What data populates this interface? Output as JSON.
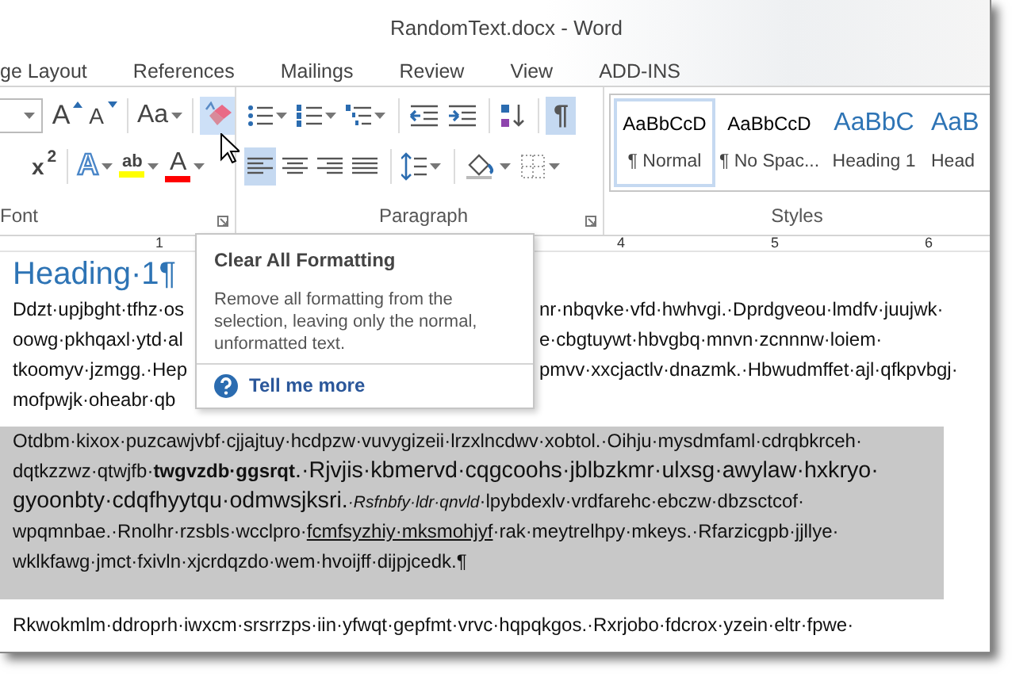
{
  "window": {
    "title": "RandomText.docx - Word"
  },
  "tabs": [
    {
      "label": "ge Layout"
    },
    {
      "label": "References"
    },
    {
      "label": "Mailings"
    },
    {
      "label": "Review"
    },
    {
      "label": "View"
    },
    {
      "label": "ADD-INS"
    }
  ],
  "font_group": {
    "label": "Font",
    "row1": [
      {
        "kind": "size_box"
      },
      {
        "kind": "grow",
        "glyph": "A"
      },
      {
        "kind": "shrink",
        "glyph": "A"
      },
      {
        "kind": "case",
        "glyph": "Aa"
      },
      {
        "kind": "clear",
        "hover": true
      }
    ],
    "row2": [
      {
        "kind": "superscript",
        "glyph": "x$^{2}$"
      },
      {
        "kind": "effects",
        "glyph": "A"
      },
      {
        "kind": "highlight",
        "glyph": "ab",
        "color": "#ffff00"
      },
      {
        "kind": "font_color",
        "glyph": "A",
        "color": "#ff0000"
      }
    ]
  },
  "paragraph_group": {
    "label": "Paragraph",
    "row1": [
      {
        "kind": "bullets"
      },
      {
        "kind": "numbering"
      },
      {
        "kind": "multilevel"
      },
      {
        "kind": "outdent"
      },
      {
        "kind": "indent"
      },
      {
        "kind": "sort"
      },
      {
        "kind": "pilcrow",
        "glyph": "¶",
        "selected": true
      }
    ],
    "row2": [
      {
        "kind": "align_left",
        "selected": true
      },
      {
        "kind": "align_center",
        "selected": false
      },
      {
        "kind": "align_right",
        "selected": false
      },
      {
        "kind": "justify",
        "selected": false
      },
      {
        "kind": "line_spacing"
      },
      {
        "kind": "shading"
      },
      {
        "kind": "borders"
      }
    ]
  },
  "styles_group": {
    "label": "Styles",
    "styles": [
      {
        "sample": "AaBbCcD",
        "name": "¶ Normal",
        "kind": "body",
        "selected": true
      },
      {
        "sample": "AaBbCcD",
        "name": "¶ No Spac...",
        "kind": "body",
        "selected": false
      },
      {
        "sample": "AaBbC",
        "name": "Heading 1",
        "kind": "heading",
        "selected": false
      },
      {
        "sample": "AaB",
        "name": "Head",
        "kind": "heading",
        "selected": false
      }
    ]
  },
  "ruler": [
    {
      "kind": "number",
      "label": "1"
    },
    {
      "kind": "gap"
    },
    {
      "kind": "gap"
    },
    {
      "kind": "number",
      "label": "4"
    },
    {
      "kind": "number",
      "label": "5"
    },
    {
      "kind": "number",
      "label": "6"
    }
  ],
  "document": {
    "heading": "Heading·1¶",
    "paragraphs": [
      {
        "selected": false,
        "lines": [
          [
            {
              "kind": "plain",
              "text": "Ddzt·upjbght·tfhz·os"
            },
            {
              "kind": "covered"
            },
            {
              "kind": "plain",
              "text": "nr·nbqvke·vfd·hwhvgi.·Dprdgveou·lmdfv·juujwk·"
            }
          ],
          [
            {
              "kind": "plain",
              "text": "oowg·pkhqaxl·ytd·al"
            },
            {
              "kind": "covered"
            },
            {
              "kind": "plain",
              "text": "e·cbgtuywt·hbvgbq·mnvn·zcnnnw·loiem·"
            }
          ],
          [
            {
              "kind": "plain",
              "text": "tkoomyv·jzmgg.·Hep"
            },
            {
              "kind": "covered"
            },
            {
              "kind": "plain",
              "text": "pmvv·xxcjactlv·dnazmk.·Hbwudmffet·ajl·qfkpvbgj·"
            }
          ],
          [
            {
              "kind": "plain",
              "text": "mofpwjk·oheabr·qb"
            },
            {
              "kind": "covered"
            }
          ]
        ]
      },
      {
        "selected": true,
        "lines": [
          [
            {
              "kind": "plain",
              "text": "Otdbm·kixox·puzcawjvbf·cjjajtuy·hcdpzw·vuvygizeii·lrzxlncdwv·xobtol.·Oihju·mysdmfaml·cdrqbkrceh·"
            }
          ],
          [
            {
              "kind": "plain",
              "text": "dqtkzzwz·qtwjfb·"
            },
            {
              "kind": "bold",
              "text": "twgvzdb·ggsrqt"
            },
            {
              "kind": "large",
              "text": ".·Rjvjis·kbmervd·cqgcoohs·jblbzkmr·ulxsg·awylaw·hxkryo·"
            }
          ],
          [
            {
              "kind": "large",
              "text": "gyoonbty·cdqfhyytqu·odmwsjksri."
            },
            {
              "kind": "small_italic",
              "text": "·Rsfnbfy·ldr·qnvld"
            },
            {
              "kind": "plain",
              "text": "·lpybdexlv·vrdfarehc·ebczw·dbzsctcof·"
            }
          ],
          [
            {
              "kind": "plain",
              "text": "wpqmnbae.·Rnolhr·rzsbls·wcclpro·"
            },
            {
              "kind": "underline",
              "text": "fcmfsyzhiy·mksmohjyf"
            },
            {
              "kind": "plain",
              "text": "·rak·meytrelhpy·mkeys.·Rfarzicgpb·jjllye·"
            }
          ],
          [
            {
              "kind": "plain",
              "text": "wklkfawg·jmct·fxivln·xjcrdqzdo·wem·hvoijff·dijpjcedk.¶"
            }
          ]
        ]
      },
      {
        "selected": false,
        "lines": [
          [
            {
              "kind": "plain",
              "text": "Rkwokmlm·ddroprh·iwxcm·srsrrzps·iin·yfwqt·gepfmt·vrvc·hqpqkgos.·Rxrjobo·fdcrox·yzein·eltr·fpwe·"
            }
          ]
        ]
      }
    ]
  },
  "tooltip": {
    "title": "Clear All Formatting",
    "description": "Remove all formatting from the selection, leaving only the normal, unformatted text.",
    "link": "Tell me more"
  }
}
